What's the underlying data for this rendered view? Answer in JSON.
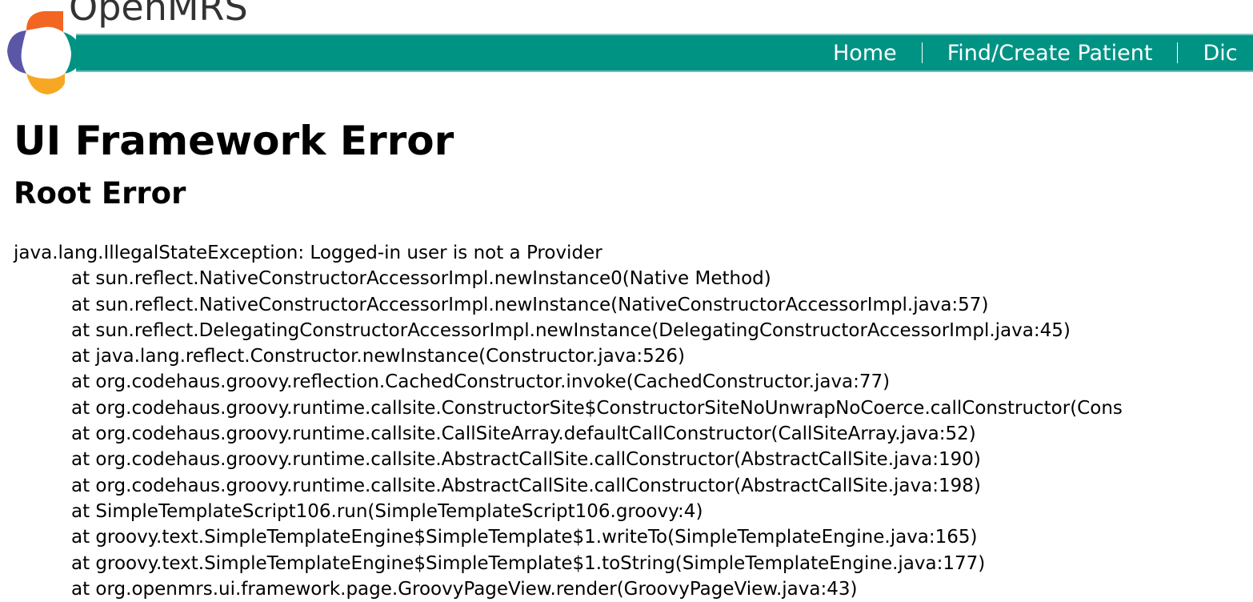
{
  "brand": {
    "name": "OpenMRS",
    "colors": {
      "teal": "#009384",
      "orange": "#f26522",
      "purple": "#5b57a6",
      "yellow": "#f7a823"
    }
  },
  "nav": {
    "items": [
      "Home",
      "Find/Create Patient",
      "Dic"
    ]
  },
  "page": {
    "title": "UI Framework Error",
    "subtitle": "Root Error"
  },
  "error": {
    "exception": "java.lang.IllegalStateException: Logged-in user is not a Provider",
    "frames": [
      "at sun.reflect.NativeConstructorAccessorImpl.newInstance0(Native Method)",
      "at sun.reflect.NativeConstructorAccessorImpl.newInstance(NativeConstructorAccessorImpl.java:57)",
      "at sun.reflect.DelegatingConstructorAccessorImpl.newInstance(DelegatingConstructorAccessorImpl.java:45)",
      "at java.lang.reflect.Constructor.newInstance(Constructor.java:526)",
      "at org.codehaus.groovy.reflection.CachedConstructor.invoke(CachedConstructor.java:77)",
      "at org.codehaus.groovy.runtime.callsite.ConstructorSite$ConstructorSiteNoUnwrapNoCoerce.callConstructor(Cons",
      "at org.codehaus.groovy.runtime.callsite.CallSiteArray.defaultCallConstructor(CallSiteArray.java:52)",
      "at org.codehaus.groovy.runtime.callsite.AbstractCallSite.callConstructor(AbstractCallSite.java:190)",
      "at org.codehaus.groovy.runtime.callsite.AbstractCallSite.callConstructor(AbstractCallSite.java:198)",
      "at SimpleTemplateScript106.run(SimpleTemplateScript106.groovy:4)",
      "at groovy.text.SimpleTemplateEngine$SimpleTemplate$1.writeTo(SimpleTemplateEngine.java:165)",
      "at groovy.text.SimpleTemplateEngine$SimpleTemplate$1.toString(SimpleTemplateEngine.java:177)",
      "at org.openmrs.ui.framework.page.GroovyPageView.render(GroovyPageView.java:43)"
    ]
  }
}
